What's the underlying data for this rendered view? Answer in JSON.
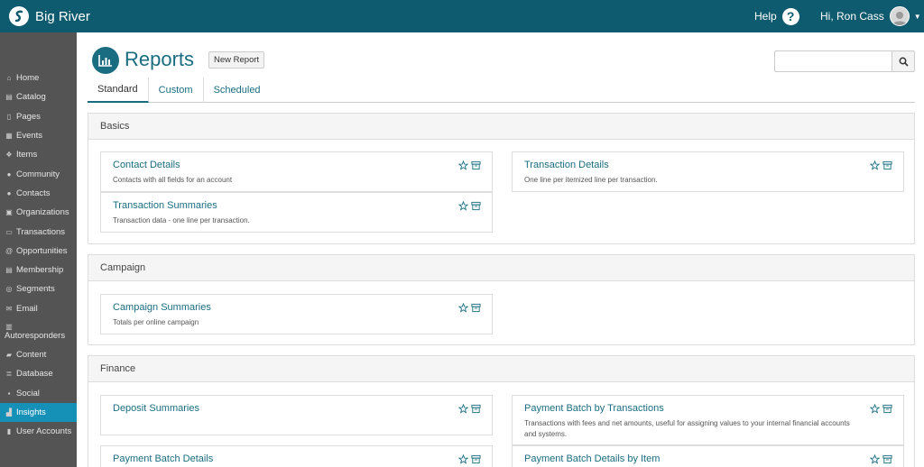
{
  "app": {
    "name": "Big River"
  },
  "header": {
    "help_label": "Help",
    "help_glyph": "?",
    "greeting": "Hi, Ron Cass",
    "caret": "▼"
  },
  "sidebar": {
    "items": [
      {
        "label": "Home",
        "icon": "home-icon",
        "glyph": "⌂"
      },
      {
        "label": "Catalog",
        "icon": "cart-icon",
        "glyph": "▤"
      },
      {
        "label": "Pages",
        "icon": "pages-icon",
        "glyph": "▯"
      },
      {
        "label": "Events",
        "icon": "calendar-icon",
        "glyph": "▦"
      },
      {
        "label": "Items",
        "icon": "items-icon",
        "glyph": "❖"
      },
      {
        "label": "Community",
        "icon": "community-icon",
        "glyph": "●"
      },
      {
        "label": "Contacts",
        "icon": "contacts-icon",
        "glyph": "●"
      },
      {
        "label": "Organizations",
        "icon": "organizations-icon",
        "glyph": "▣"
      },
      {
        "label": "Transactions",
        "icon": "transactions-icon",
        "glyph": "▭"
      },
      {
        "label": "Opportunities",
        "icon": "opportunities-icon",
        "glyph": "@"
      },
      {
        "label": "Membership",
        "icon": "membership-icon",
        "glyph": "▤"
      },
      {
        "label": "Segments",
        "icon": "segments-icon",
        "glyph": "◎"
      },
      {
        "label": "Email",
        "icon": "email-icon",
        "glyph": "✉"
      },
      {
        "label": "Autoresponders",
        "icon": "autoresponders-icon",
        "glyph": "▥"
      },
      {
        "label": "Content",
        "icon": "folder-icon",
        "glyph": "▰"
      },
      {
        "label": "Database",
        "icon": "database-icon",
        "glyph": "≣"
      },
      {
        "label": "Social",
        "icon": "social-icon",
        "glyph": "▪"
      },
      {
        "label": "Insights",
        "icon": "chart-icon",
        "glyph": "▟"
      },
      {
        "label": "User Accounts",
        "icon": "user-accounts-icon",
        "glyph": "▮"
      }
    ]
  },
  "page": {
    "title": "Reports",
    "new_report_label": "New Report",
    "search": {
      "placeholder": ""
    },
    "tabs": [
      {
        "label": "Standard"
      },
      {
        "label": "Custom"
      },
      {
        "label": "Scheduled"
      }
    ]
  },
  "sections": [
    {
      "title": "Basics",
      "cards": [
        {
          "title": "Contact Details",
          "desc": "Contacts with all fields for an account"
        },
        {
          "title": "Transaction Details",
          "desc": "One line per itemized line per transaction."
        },
        {
          "title": "Transaction Summaries",
          "desc": "Transaction data - one line per transaction."
        }
      ]
    },
    {
      "title": "Campaign",
      "cards": [
        {
          "title": "Campaign Summaries",
          "desc": "Totals per online campaign"
        }
      ]
    },
    {
      "title": "Finance",
      "cards": [
        {
          "title": "Deposit Summaries",
          "desc": ""
        },
        {
          "title": "Payment Batch by Transactions",
          "desc": "Transactions with fees and net amounts, useful for assigning values to your internal financial accounts and systems."
        },
        {
          "title": "Payment Batch Details",
          "desc": ""
        },
        {
          "title": "Payment Batch Details by Item",
          "desc": ""
        }
      ]
    }
  ],
  "colors": {
    "topbar": "#0e5a6e",
    "sidebar": "#545454",
    "accent": "#1591b7",
    "link": "#1a6d80"
  }
}
